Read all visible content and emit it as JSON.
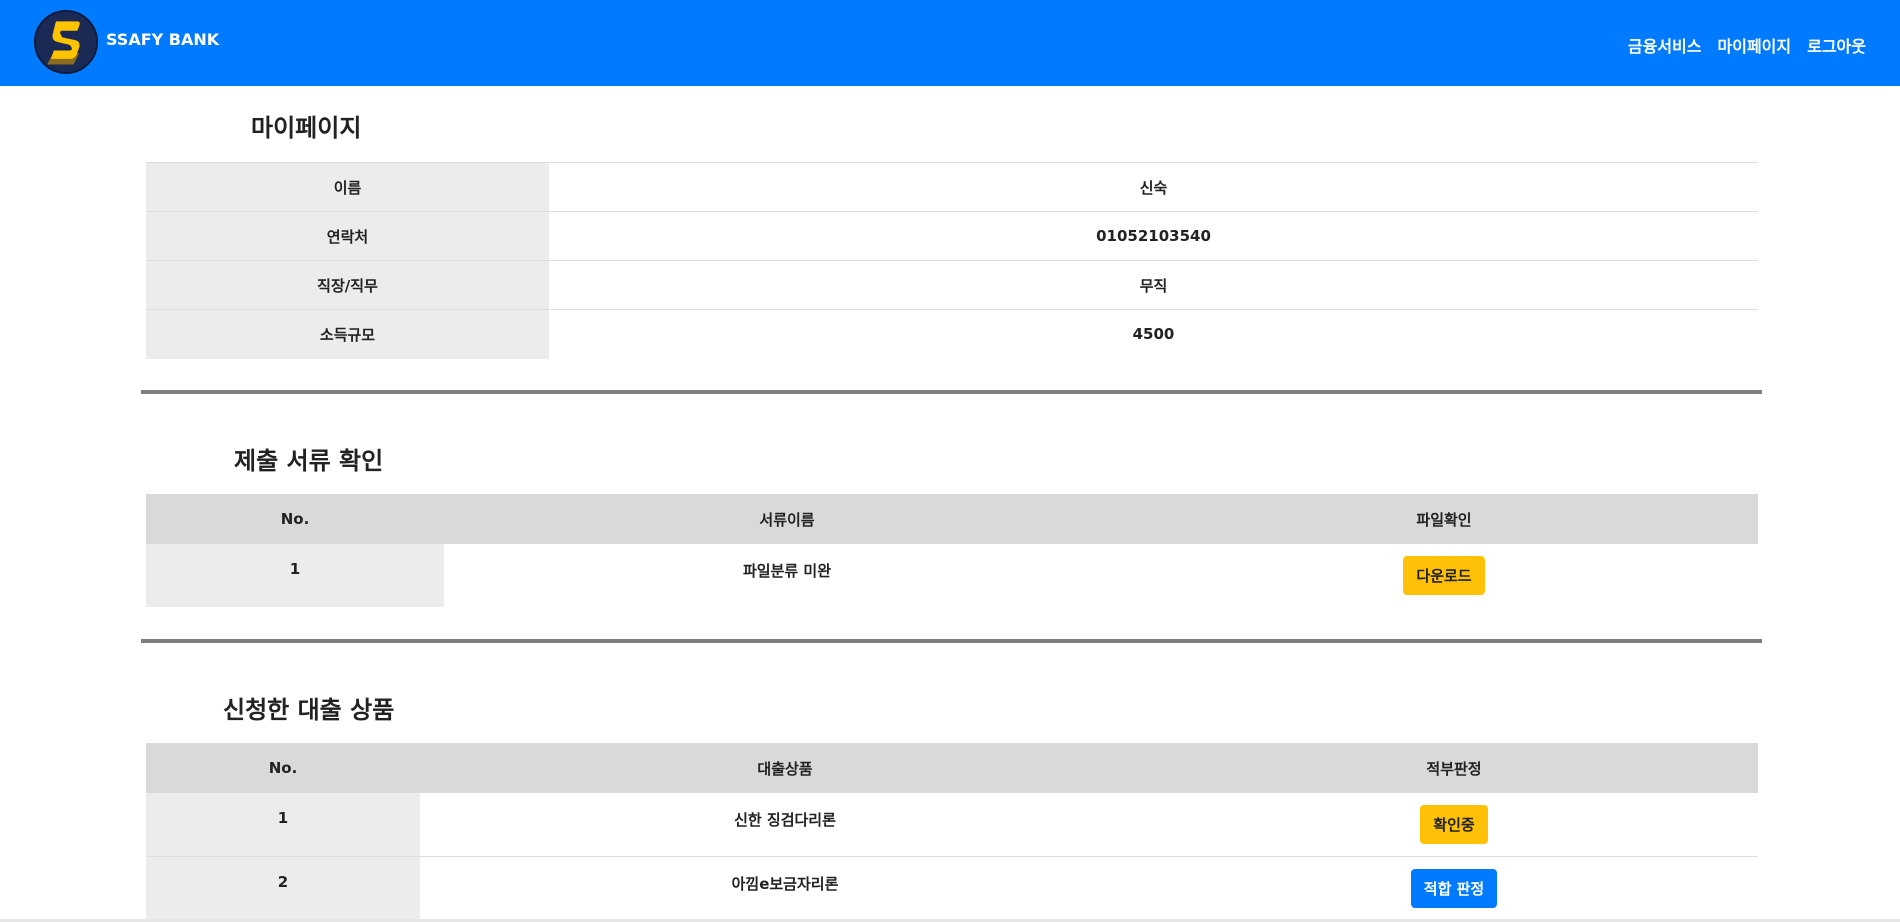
{
  "header": {
    "brand": "SSAFY BANK",
    "nav": [
      "금융서비스",
      "마이페이지",
      "로그아웃"
    ],
    "logo_icon": "ssafy-s-logo",
    "background_color": "#007bff"
  },
  "mypage": {
    "title": "마이페이지",
    "rows": [
      {
        "label": "이름",
        "value": "신숙"
      },
      {
        "label": "연락처",
        "value": "01052103540"
      },
      {
        "label": "직장/직무",
        "value": "무직"
      },
      {
        "label": "소득규모",
        "value": "4500"
      }
    ]
  },
  "documents": {
    "title": "제출 서류 확인",
    "headers": [
      "No.",
      "서류이름",
      "파일확인"
    ],
    "rows": [
      {
        "no": "1",
        "name": "파일분류 미완",
        "action": "다운로드"
      }
    ]
  },
  "loans": {
    "title": "신청한 대출 상품",
    "headers": [
      "No.",
      "대출상품",
      "적부판정"
    ],
    "rows": [
      {
        "no": "1",
        "product": "신한 징검다리론",
        "status": "확인중",
        "status_color": "#ffc107"
      },
      {
        "no": "2",
        "product": "아낌e보금자리론",
        "status": "적합 판정",
        "status_color": "#007bff"
      }
    ]
  }
}
